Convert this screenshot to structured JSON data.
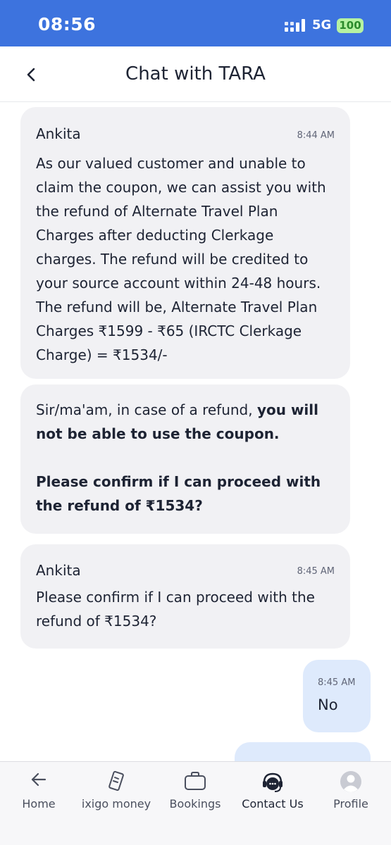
{
  "status": {
    "time": "08:56",
    "network": "5G",
    "battery": "100"
  },
  "header": {
    "title": "Chat with TARA"
  },
  "messages": [
    {
      "sender": "Ankita",
      "time": "8:44 AM",
      "text": "As our valued customer and unable to claim the coupon, we can assist you with the refund of Alternate Travel Plan Charges after deducting Clerkage charges. The refund will be credited to your source account within 24-48 hours. The refund will be, Alternate Travel Plan Charges ₹1599 - ₹65 (IRCTC Clerkage Charge) = ₹1534/-"
    },
    {
      "text_normal": "Sir/ma'am, in case of a refund, ",
      "text_bold": "you will not be able to use the coupon.",
      "text_confirm": "Please confirm if I can proceed with the refund of ₹1534?"
    },
    {
      "sender": "Ankita",
      "time": "8:45 AM",
      "text": "Please confirm if I can proceed with the refund of ₹1534?"
    }
  ],
  "reply": {
    "time": "8:45 AM",
    "text": "No"
  },
  "nav": [
    {
      "label": "Home",
      "icon": "arrow-left-icon"
    },
    {
      "label": "ixigo money",
      "icon": "wallet-icon"
    },
    {
      "label": "Bookings",
      "icon": "briefcase-icon"
    },
    {
      "label": "Contact Us",
      "icon": "support-chat-icon",
      "active": true
    },
    {
      "label": "Profile",
      "icon": "avatar-icon"
    }
  ],
  "colors": {
    "status_bar": "#3d73de",
    "incoming_bubble": "#f1f1f4",
    "outgoing_bubble": "#deeafc",
    "battery": "#b6f2a2"
  }
}
